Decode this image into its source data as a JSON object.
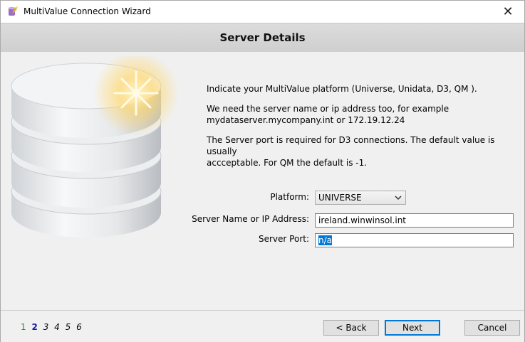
{
  "window": {
    "title": "MultiValue Connection Wizard",
    "close_glyph": "✕"
  },
  "header": {
    "title": "Server Details"
  },
  "description": {
    "line1": "Indicate your MultiValue platform (Universe, Unidata, D3, QM ).",
    "line2a": "We need the server name or ip address too, for example",
    "line2b": "mydataserver.mycompany.int or 172.19.12.24",
    "line3a": "The Server port is required for D3 connections.  The default value is usually",
    "line3b": "accceptable.  For QM the default is -1."
  },
  "form": {
    "platform_label": "Platform:",
    "platform_value": "UNIVERSE",
    "server_label": "Server Name or IP Address:",
    "server_value": "ireland.winwinsol.int",
    "port_label": "Server Port:",
    "port_value": "n/a"
  },
  "footer": {
    "steps": [
      "1",
      "2",
      "3",
      "4",
      "5",
      "6"
    ],
    "current_step": "2",
    "back_label": "< Back",
    "next_label": "Next",
    "cancel_label": "Cancel"
  },
  "colors": {
    "accent": "#0078d7",
    "step_done": "#2e8b2e",
    "step_current": "#1a1aa6"
  },
  "icons": {
    "app": "database-wizard-icon",
    "close": "close-icon",
    "dropdown": "chevron-down-icon"
  }
}
